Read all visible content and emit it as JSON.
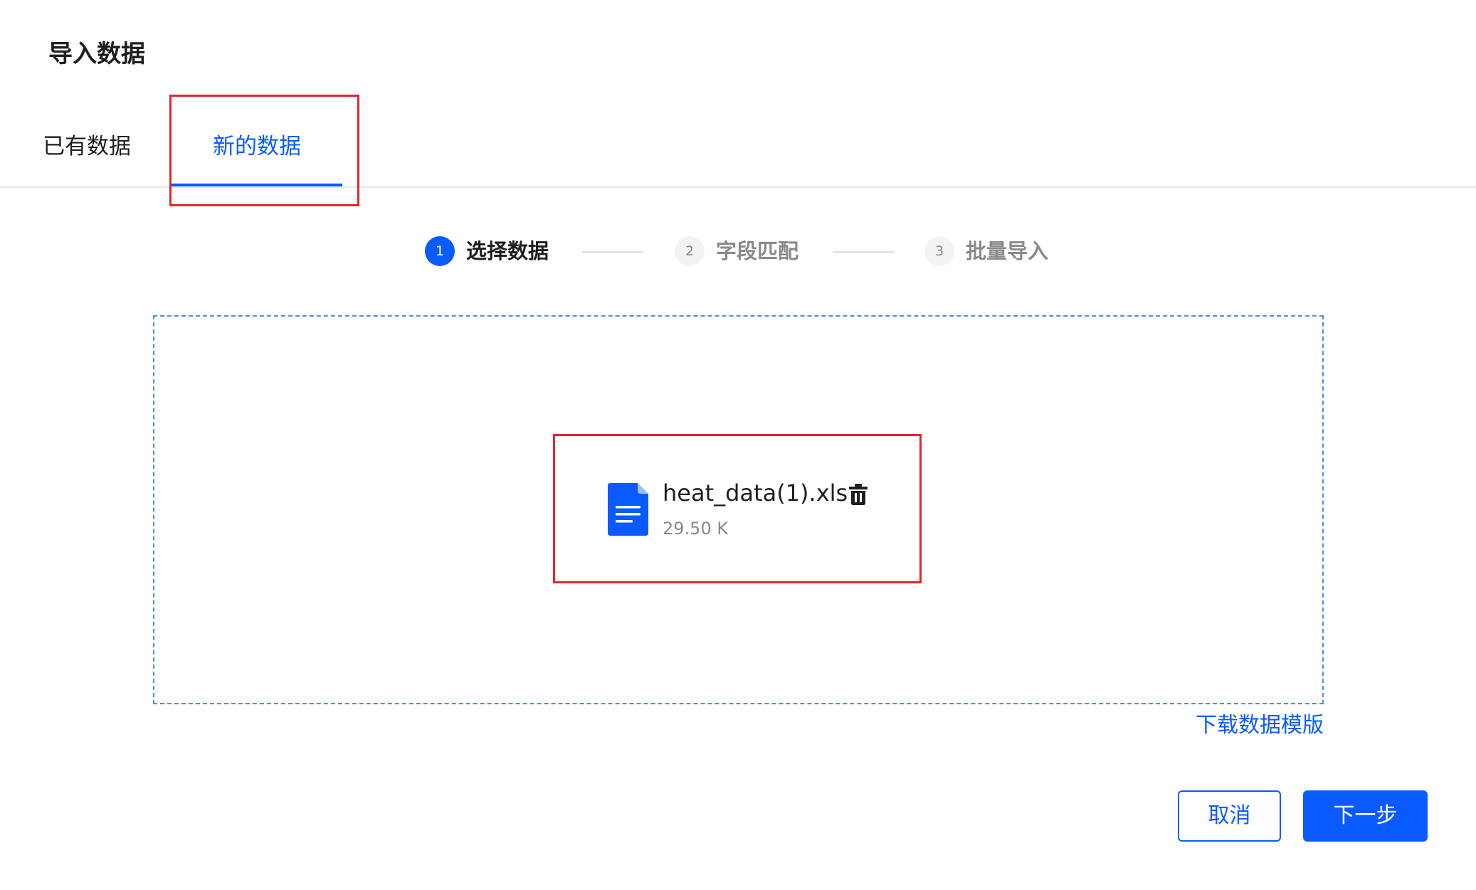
{
  "dialog": {
    "title": "导入数据"
  },
  "tabs": [
    {
      "label": "已有数据",
      "active": false
    },
    {
      "label": "新的数据",
      "active": true
    }
  ],
  "steps": [
    {
      "number": "1",
      "label": "选择数据",
      "status": "active"
    },
    {
      "number": "2",
      "label": "字段匹配",
      "status": "pending"
    },
    {
      "number": "3",
      "label": "批量导入",
      "status": "pending"
    }
  ],
  "upload": {
    "file_name": "heat_data(1).xls",
    "file_size": "29.50 K",
    "file_icon": "document-icon",
    "delete_icon": "trash-icon"
  },
  "links": {
    "download_template": "下载数据模版"
  },
  "buttons": {
    "cancel": "取消",
    "next": "下一步"
  },
  "colors": {
    "primary": "#0a5bff",
    "highlight": "#e3262c",
    "dropzone_border": "#4a90e2"
  }
}
